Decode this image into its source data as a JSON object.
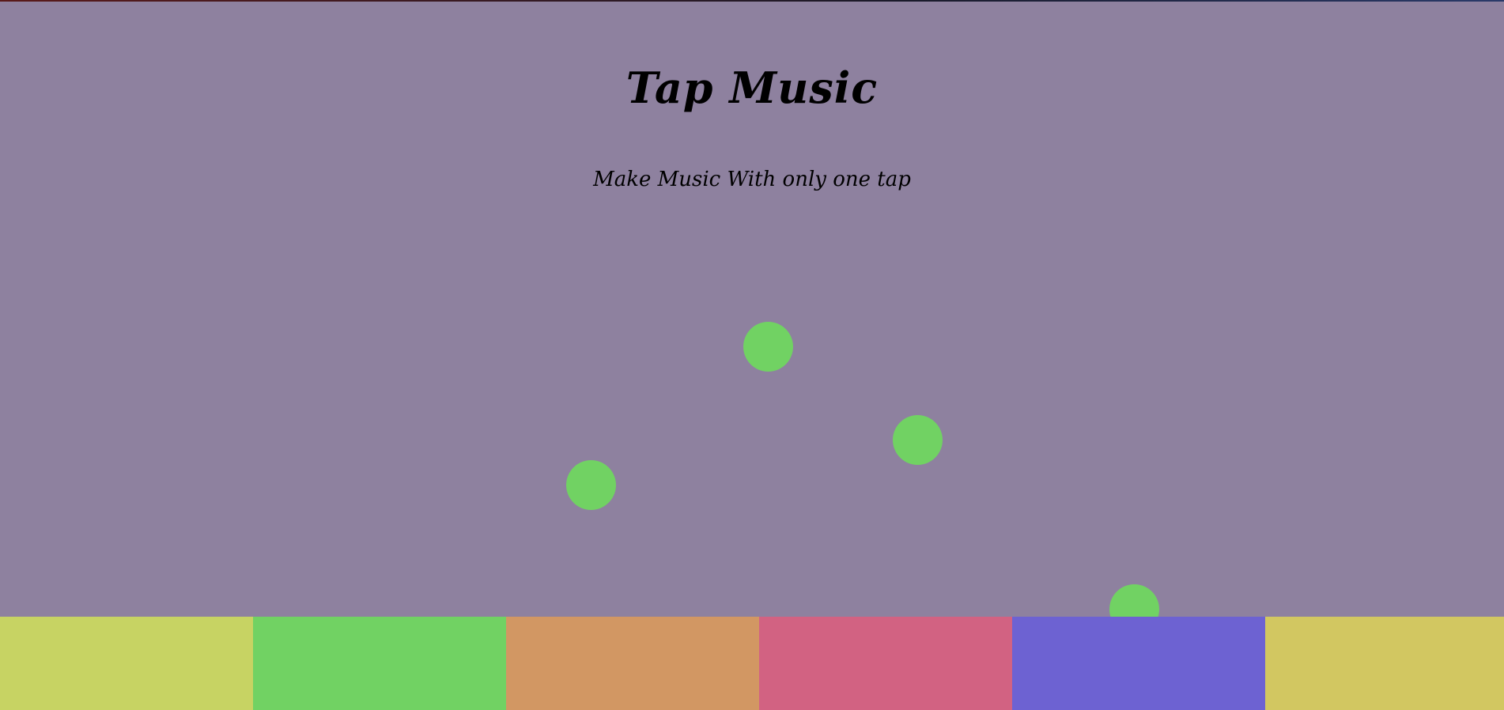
{
  "app": {
    "title": "Tap Music",
    "subtitle": "Make Music With only one tap"
  },
  "colors": {
    "background": "#8e819f",
    "ball": "#71d263",
    "pads": [
      "#c7d363",
      "#71d263",
      "#d29763",
      "#d26282",
      "#6d62d2",
      "#d2c761"
    ]
  },
  "pads": [
    {
      "name": "pad-1"
    },
    {
      "name": "pad-2"
    },
    {
      "name": "pad-3"
    },
    {
      "name": "pad-4"
    },
    {
      "name": "pad-5"
    },
    {
      "name": "pad-6"
    }
  ],
  "balls_count": 4
}
